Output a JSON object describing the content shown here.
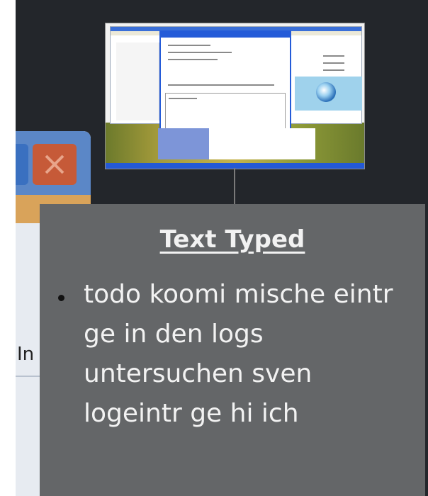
{
  "background_window": {
    "partial_text": "In",
    "close_icon": "close-icon"
  },
  "thumbnail": {
    "icon": "desktop-screenshot-thumbnail"
  },
  "panel": {
    "title": "Text Typed",
    "items": [
      "todo koomi mische eintr\nge in den logs\nuntersuchen sven\nlogeintr ge hi ich"
    ]
  },
  "colors": {
    "background": "#23262b",
    "panel": "#646668",
    "panel_text": "#f2f2f2",
    "close_button": "#c65a38"
  }
}
